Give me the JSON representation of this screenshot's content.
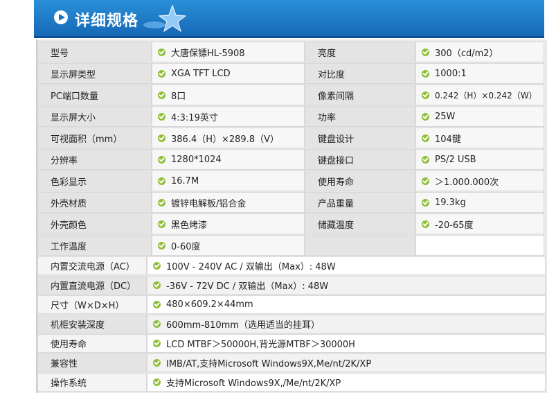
{
  "header": {
    "title": "详细规格"
  },
  "specs_left": [
    {
      "label": "型号",
      "value": "大唐保镖HL-5908"
    },
    {
      "label": "显示屏类型",
      "value": "XGA TFT LCD"
    },
    {
      "label": "PC端口数量",
      "value": "8口"
    },
    {
      "label": "显示屏大小",
      "value": "4:3:19英寸"
    },
    {
      "label": "可视面积（mm）",
      "value": "386.4（H）×289.8（V）"
    },
    {
      "label": "分辨率",
      "value": "1280*1024"
    },
    {
      "label": "色彩显示",
      "value": "16.7M"
    },
    {
      "label": "外壳材质",
      "value": "镀锌电解板/铝合金"
    },
    {
      "label": "外壳颜色",
      "value": "黑色烤漆"
    },
    {
      "label": "工作温度",
      "value": "0-60度"
    }
  ],
  "specs_right": [
    {
      "label": "亮度",
      "value": "300（cd/m2）"
    },
    {
      "label": "对比度",
      "value": "1000:1"
    },
    {
      "label": "像素间隔",
      "value": "0.242（H）×0.242（W）"
    },
    {
      "label": "功率",
      "value": "25W"
    },
    {
      "label": "键盘设计",
      "value": "104键"
    },
    {
      "label": "键盘接口",
      "value": "PS/2 USB"
    },
    {
      "label": "使用寿命",
      "value": "＞1.000.000次"
    },
    {
      "label": "产品重量",
      "value": "19.3kg"
    },
    {
      "label": "储藏温度",
      "value": "-20-65度"
    }
  ],
  "specs_full": [
    {
      "label": "内置交流电源（AC）",
      "value": "100V - 240V AC / 双输出（Max）: 48W"
    },
    {
      "label": "内置直流电源（DC）",
      "value": "-36V - 72V DC / 双输出（Max）: 48W"
    },
    {
      "label": "尺寸（W×D×H）",
      "value": "480×609.2×44mm"
    },
    {
      "label": "机柜安装深度",
      "value": "600mm-810mm（选用适当的挂耳）"
    },
    {
      "label": "使用寿命",
      "value": "LCD MTBF＞50000H,背光源MTBF＞30000H"
    },
    {
      "label": "兼容性",
      "value": "IMB/AT,支持Microsoft Windows9X,Me/nt/2K/XP"
    },
    {
      "label": "操作系统",
      "value": "支持Microsoft Windows9X,/Me/nt/2K/XP"
    }
  ]
}
